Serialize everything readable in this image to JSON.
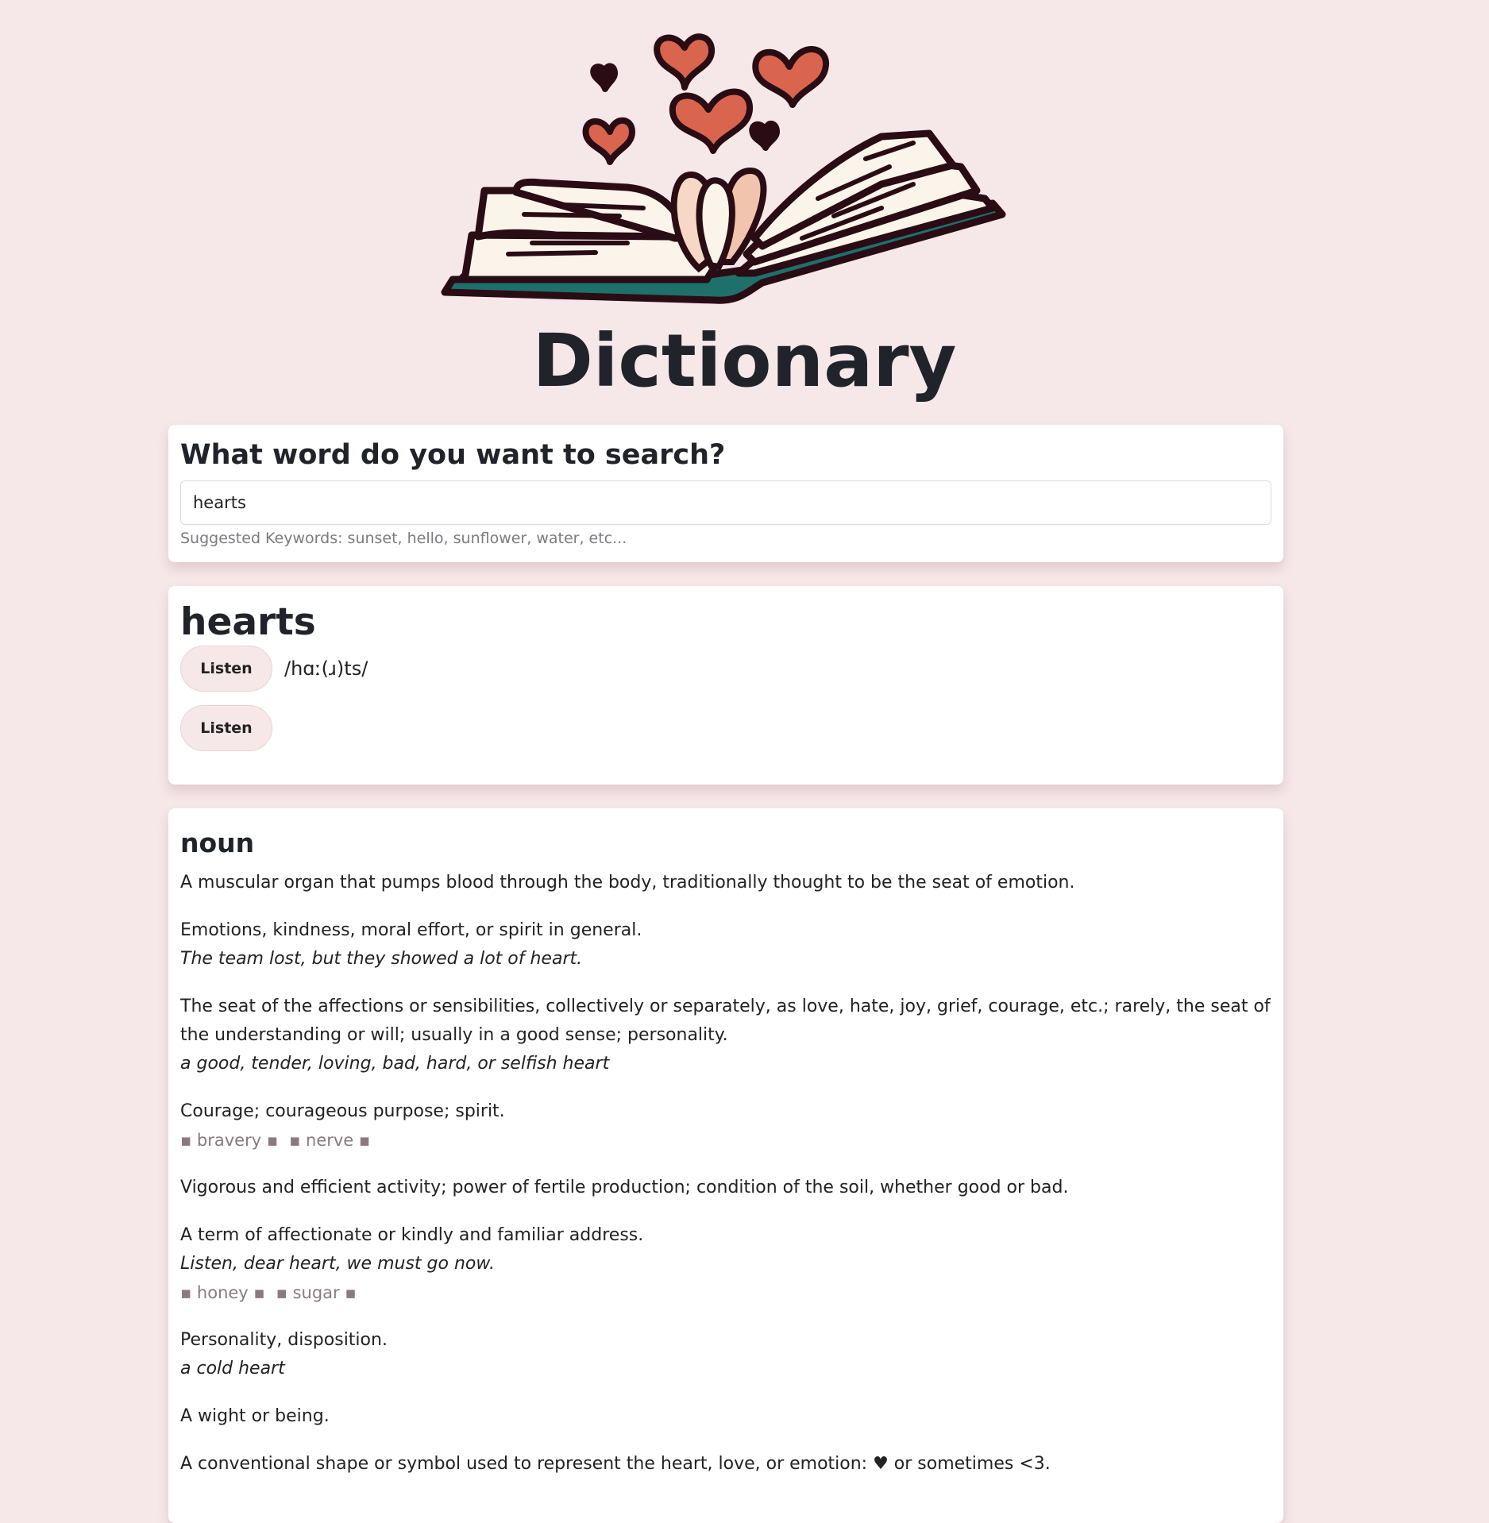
{
  "app": {
    "title": "Dictionary"
  },
  "search": {
    "heading": "What word do you want to search?",
    "value": "hearts",
    "hint": "Suggested Keywords: sunset, hello, sunflower, water, etc..."
  },
  "word": {
    "text": "hearts",
    "phonetic": "/hɑː(ɹ)ts/",
    "listen_label_1": "Listen",
    "listen_label_2": "Listen"
  },
  "meaning": {
    "part_of_speech": "noun",
    "definitions": [
      {
        "definition": "A muscular organ that pumps blood through the body, traditionally thought to be the seat of emotion."
      },
      {
        "definition": "Emotions, kindness, moral effort, or spirit in general.",
        "example": "The team lost, but they showed a lot of heart."
      },
      {
        "definition": "The seat of the affections or sensibilities, collectively or separately, as love, hate, joy, grief, courage, etc.; rarely, the seat of the understanding or will; usually in a good sense; personality.",
        "example": "a good, tender, loving, bad, hard, or selfish heart"
      },
      {
        "definition": "Courage; courageous purpose; spirit.",
        "synonyms": [
          "bravery",
          "nerve"
        ]
      },
      {
        "definition": "Vigorous and efficient activity; power of fertile production; condition of the soil, whether good or bad."
      },
      {
        "definition": "A term of affectionate or kindly and familiar address.",
        "example": "Listen, dear heart, we must go now.",
        "synonyms": [
          "honey",
          "sugar"
        ]
      },
      {
        "definition": "Personality, disposition.",
        "example": "a cold heart"
      },
      {
        "definition": "A wight or being."
      },
      {
        "definition": "A conventional shape or symbol used to represent the heart, love, or emotion: ♥ or sometimes <3."
      }
    ]
  },
  "colors": {
    "background": "#f6e7e9",
    "card": "#ffffff",
    "heart": "#d9654f",
    "book_cover": "#1f6f6b",
    "outline": "#2a0c14"
  },
  "icons": {
    "hero": "open-book-with-hearts-illustration"
  }
}
